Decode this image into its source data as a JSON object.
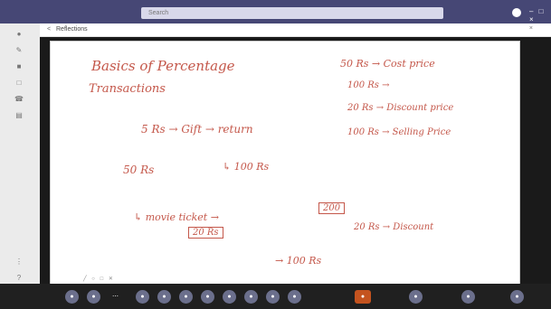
{
  "titlebar": {
    "search_placeholder": "Search",
    "window_controls": "– □ ×"
  },
  "document": {
    "back_symbol": "<",
    "name": "Reflections",
    "close_symbol": "×"
  },
  "whiteboard": {
    "lines": [
      "Basics of Percentage",
      "Transactions",
      "50 Rs → Cost price",
      "100 Rs →",
      "20 Rs → Discount price",
      "100 Rs → Selling Price",
      "5 Rs → Gift → return",
      "50 Rs",
      "↳ 100 Rs",
      "↳ movie ticket →",
      "200",
      "20 Rs",
      "20 Rs → Discount",
      "→ 100 Rs"
    ]
  },
  "rail_icons": [
    "activity-icon",
    "chat-icon",
    "teams-icon",
    "calendar-icon",
    "calls-icon",
    "files-icon",
    "apps-icon",
    "help-icon"
  ],
  "pen_tools": "╱ ○ □ ✕",
  "controls": {
    "items": [
      "camera-icon",
      "mic-icon",
      "more-icon",
      "share-icon",
      "people-icon",
      "chat-icon",
      "raise-hand-icon",
      "reactions-icon",
      "record-icon",
      "layout-icon",
      "settings-icon",
      "leave-call-icon",
      "device-icon",
      "more-options-icon",
      "end-icon"
    ]
  },
  "colors": {
    "titlebar": "#464775",
    "ink": "#c4574a",
    "stage": "#1a1a1a",
    "control_bar": "#202020",
    "leave_button": "#c4531f"
  }
}
